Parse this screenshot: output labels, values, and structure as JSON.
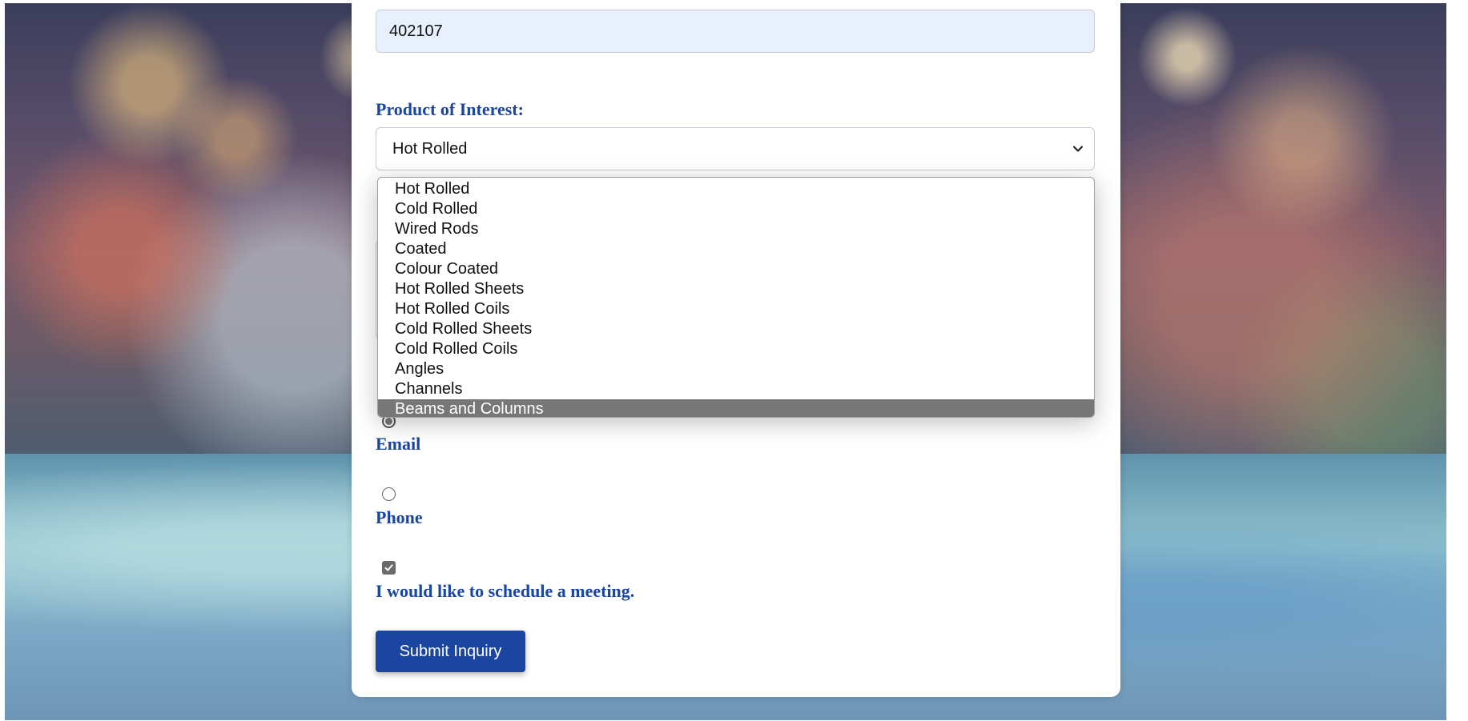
{
  "form": {
    "pincode_value": "402107",
    "product_label": "Product of Interest:",
    "product_selected": "Hot Rolled",
    "product_options": [
      "Hot Rolled",
      "Cold Rolled",
      "Wired Rods",
      "Coated",
      "Colour Coated",
      "Hot Rolled Sheets",
      "Hot Rolled Coils",
      "Cold Rolled Sheets",
      "Cold Rolled Coils",
      "Angles",
      "Channels",
      "Beams and Columns"
    ],
    "highlighted_option": "Beams and Columns",
    "contact_email_label": "Email",
    "contact_phone_label": "Phone",
    "contact_selected": "Email",
    "meeting_label": "I would like to schedule a meeting.",
    "meeting_checked": true,
    "submit_label": "Submit Inquiry"
  },
  "colors": {
    "accent": "#1a45a0",
    "input_autofill_bg": "#e8f0fe",
    "option_highlight": "#777777"
  },
  "icons": {
    "select_arrow": "chevron-down-icon",
    "checkbox_mark": "checkmark-icon"
  }
}
